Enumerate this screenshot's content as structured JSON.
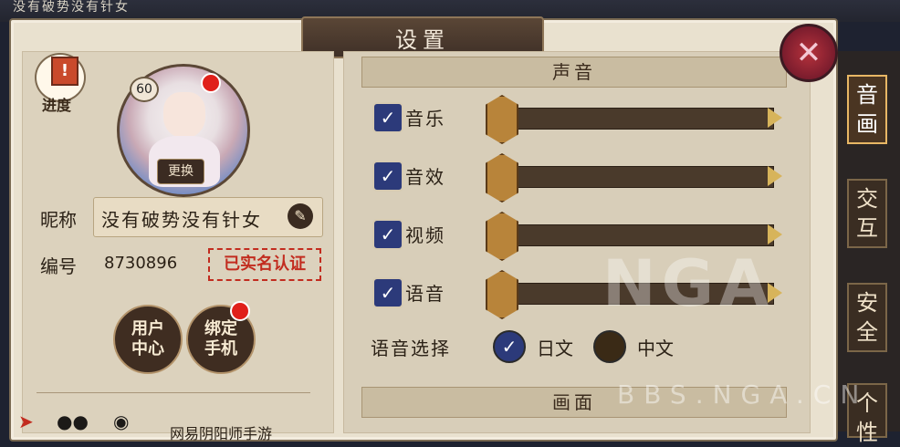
{
  "top": {
    "nickname_echo": "没有破势没有针女"
  },
  "title": "设置",
  "progress": {
    "label": "进度",
    "flag": "!"
  },
  "avatar": {
    "level": "60",
    "change_label": "更换"
  },
  "profile": {
    "nickname_label": "昵称",
    "nickname": "没有破势没有针女",
    "id_label": "编号",
    "id_value": "8730896",
    "verified": "已实名认证"
  },
  "buttons": {
    "user_center": "用户中心",
    "bind_phone": "绑定手机"
  },
  "bottom": {
    "text": "网易阴阳师手游"
  },
  "sections": {
    "sound": "声音",
    "display": "画面"
  },
  "sound_rows": [
    {
      "label": "音乐",
      "checked": true,
      "level": 0
    },
    {
      "label": "音效",
      "checked": true,
      "level": 0
    },
    {
      "label": "视频",
      "checked": true,
      "level": 0
    },
    {
      "label": "语音",
      "checked": true,
      "level": 0
    }
  ],
  "voice": {
    "label": "语音选择",
    "options": [
      {
        "label": "日文",
        "selected": true
      },
      {
        "label": "中文",
        "selected": false
      }
    ]
  },
  "side_tabs": [
    {
      "label": "音画",
      "active": true
    },
    {
      "label": "交互",
      "active": false
    },
    {
      "label": "安全",
      "active": false
    },
    {
      "label": "个性",
      "active": false
    }
  ],
  "watermark": {
    "logo": "NGA",
    "url": "BBS.NGA.CN"
  },
  "colors": {
    "accent": "#2c3a7a",
    "danger": "#c22c1f",
    "panel": "#e9e1cf"
  }
}
